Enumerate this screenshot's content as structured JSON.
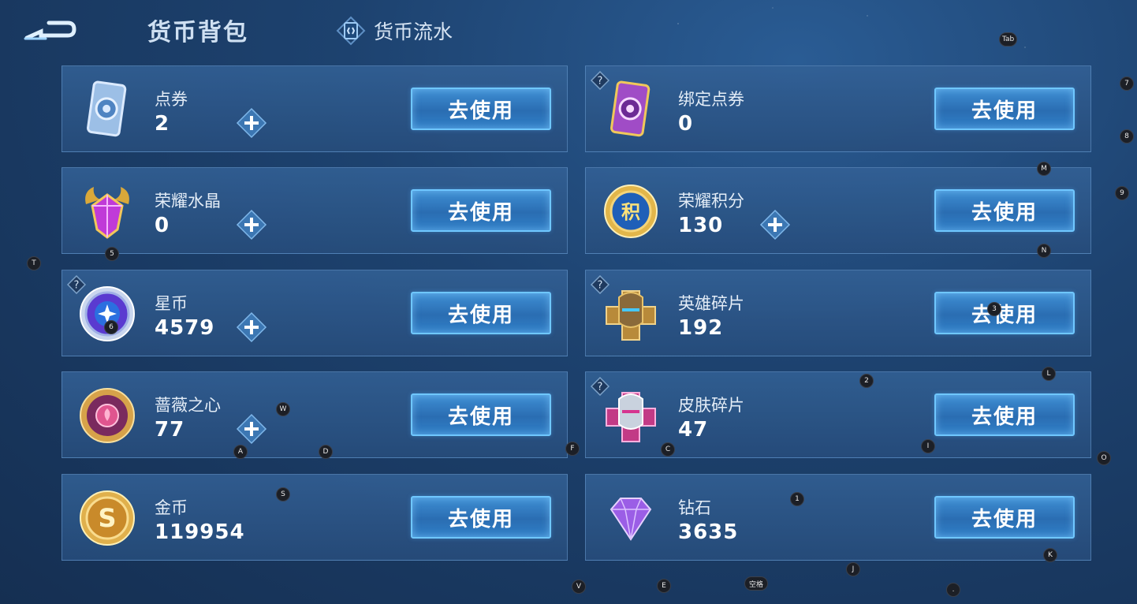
{
  "header": {
    "title": "货币背包",
    "flow_tab_label": "货币流水"
  },
  "cards": [
    {
      "name": "点券",
      "amount": "2",
      "button": "去使用",
      "has_plus": true,
      "has_help": false,
      "icon": "coupon-icon"
    },
    {
      "name": "绑定点券",
      "amount": "0",
      "button": "去使用",
      "has_plus": false,
      "has_help": true,
      "icon": "bound-coupon-icon"
    },
    {
      "name": "荣耀水晶",
      "amount": "0",
      "button": "去使用",
      "has_plus": true,
      "has_help": false,
      "icon": "glory-crystal-icon"
    },
    {
      "name": "荣耀积分",
      "amount": "130",
      "button": "去使用",
      "has_plus": true,
      "has_help": false,
      "icon": "glory-points-icon"
    },
    {
      "name": "星币",
      "amount": "4579",
      "button": "去使用",
      "has_plus": true,
      "has_help": true,
      "icon": "star-coin-icon"
    },
    {
      "name": "英雄碎片",
      "amount": "192",
      "button": "去使用",
      "has_plus": false,
      "has_help": true,
      "icon": "hero-fragment-icon"
    },
    {
      "name": "蔷薇之心",
      "amount": "77",
      "button": "去使用",
      "has_plus": true,
      "has_help": false,
      "icon": "rose-heart-icon"
    },
    {
      "name": "皮肤碎片",
      "amount": "47",
      "button": "去使用",
      "has_plus": false,
      "has_help": true,
      "icon": "skin-fragment-icon"
    },
    {
      "name": "金币",
      "amount": "119954",
      "button": "去使用",
      "has_plus": false,
      "has_help": false,
      "icon": "gold-coin-icon"
    },
    {
      "name": "钻石",
      "amount": "3635",
      "button": "去使用",
      "has_plus": false,
      "has_help": false,
      "icon": "diamond-icon"
    }
  ],
  "key_hints": {
    "tab": "Tab",
    "k7": "7",
    "k8": "8",
    "m": "M",
    "k9": "9",
    "n": "N",
    "t": "T",
    "k5": "5",
    "k6": "6",
    "k3": "3",
    "k2": "2",
    "l": "L",
    "w": "W",
    "a": "A",
    "d": "D",
    "f": "F",
    "c": "C",
    "i": "I",
    "o": "O",
    "s": "S",
    "k1": "1",
    "k": "K",
    "j": "J",
    "v": "V",
    "e": "E",
    "space": "空格",
    "dot": "."
  },
  "colors": {
    "accent": "#6fc7ff",
    "button_fill": "#2a6db2",
    "card_bg": "#2f5c92"
  }
}
